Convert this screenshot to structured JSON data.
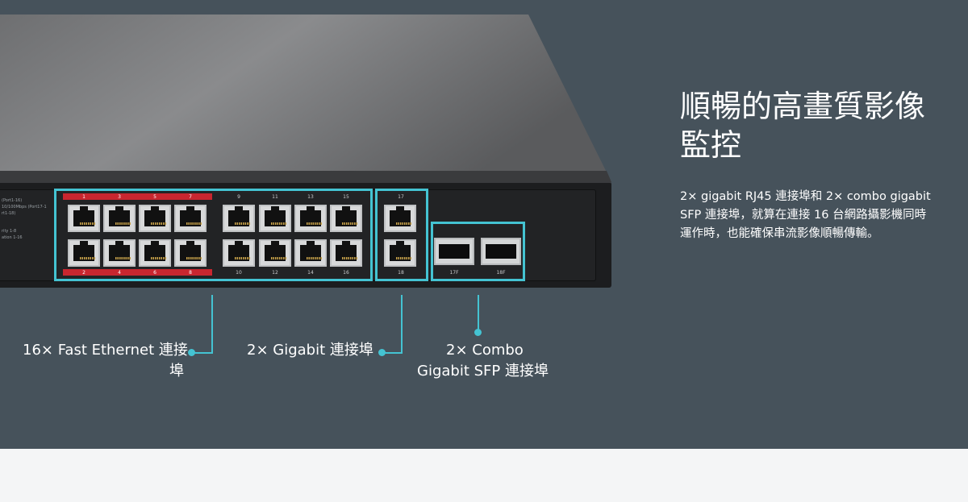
{
  "heading": {
    "line1": "順暢的高畫質影像",
    "line2": "監控"
  },
  "description": {
    "line1": "2× gigabit RJ45 連接埠和 2× combo gigabit",
    "line2": "SFP 連接埠，就算在連接 16 台網路攝影機同時",
    "line3": "運作時，也能確保串流影像順暢傳輸。"
  },
  "callouts": {
    "fast_ethernet": {
      "line1": "16× Fast Ethernet 連接",
      "line2": "埠"
    },
    "gigabit": {
      "line1": "2× Gigabit 連接埠"
    },
    "combo": {
      "line1": "2× Combo",
      "line2": "Gigabit SFP 連接埠"
    }
  },
  "switch_panel": {
    "legend": [
      "(Port1-16)",
      "10/100Mbps (Port17-1",
      "rt1-18)",
      "rity 1-8",
      "ation 1-16"
    ],
    "top_port_numbers": [
      "1",
      "3",
      "5",
      "7",
      "9",
      "11",
      "13",
      "15",
      "17"
    ],
    "bottom_port_numbers": [
      "2",
      "4",
      "6",
      "8",
      "10",
      "12",
      "14",
      "16",
      "18"
    ],
    "sfp_labels": [
      "17F",
      "18F"
    ]
  },
  "colors": {
    "background": "#46525b",
    "accent": "#44c3d2",
    "poe_red": "#c8262f",
    "footer": "#f4f5f6"
  }
}
